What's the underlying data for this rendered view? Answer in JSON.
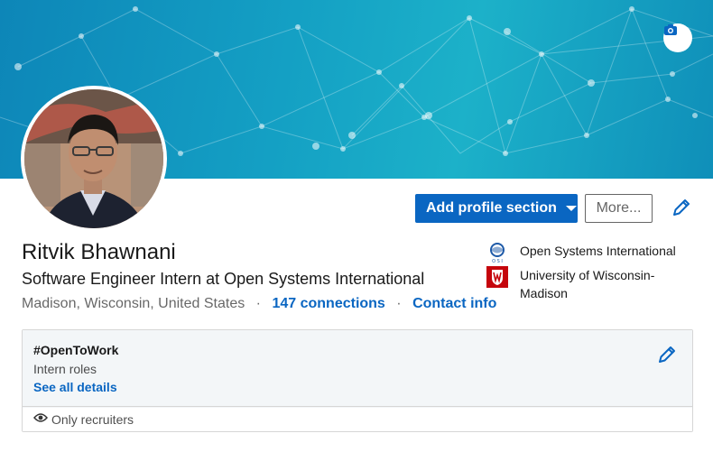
{
  "profile": {
    "name": "Ritvik Bhawnani",
    "headline": "Software Engineer Intern at Open Systems International",
    "location": "Madison, Wisconsin, United States",
    "connections": "147 connections",
    "contact": "Contact info"
  },
  "actions": {
    "add_section": "Add profile section",
    "more": "More..."
  },
  "orgs": [
    {
      "name": "Open Systems International",
      "logo_icon": "osi-logo-icon"
    },
    {
      "name": "University of Wisconsin-Madison",
      "logo_icon": "uw-crest-icon"
    }
  ],
  "open_to_work": {
    "title": "#OpenToWork",
    "roles": "Intern roles",
    "details_link": "See all details",
    "visibility": "Only recruiters"
  },
  "icons": {
    "camera": "camera-icon",
    "edit": "pencil-icon",
    "eye": "eye-icon"
  },
  "colors": {
    "primary": "#0a66c2",
    "banner": "#14a0c4",
    "panel": "#f3f6f8"
  }
}
